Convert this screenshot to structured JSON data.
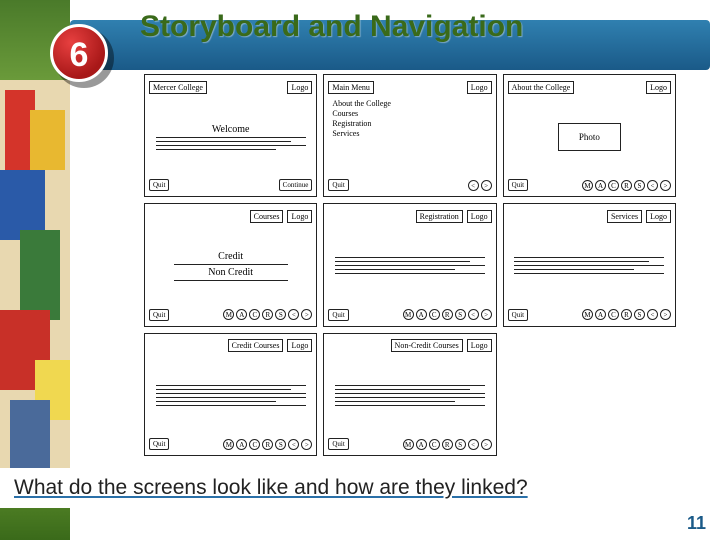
{
  "title": "Storyboard and Navigation",
  "badge_number": "6",
  "caption": "What do the screens look like and how are they linked?",
  "page_number": "11",
  "logo_label": "Logo",
  "storyboard": {
    "cells": [
      {
        "header": "Mercer College",
        "body_text": "Welcome",
        "quit": "Quit",
        "continue_btn": "Continue"
      },
      {
        "header": "Main Menu",
        "list": [
          "About the College",
          "Courses",
          "Registration",
          "Services"
        ],
        "quit": "Quit"
      },
      {
        "header": "About the College",
        "box_text": "Photo",
        "quit": "Quit",
        "nav": [
          "M",
          "A",
          "C",
          "R",
          "S"
        ]
      },
      {
        "header": "Courses",
        "body_text": "Credit",
        "body_text2": "Non Credit",
        "quit": "Quit",
        "nav": [
          "M",
          "A",
          "C",
          "R",
          "S"
        ]
      },
      {
        "header": "Registration",
        "quit": "Quit",
        "nav": [
          "M",
          "A",
          "C",
          "R",
          "S"
        ]
      },
      {
        "header": "Services",
        "quit": "Quit",
        "nav": [
          "M",
          "A",
          "C",
          "R",
          "S"
        ]
      },
      {
        "header": "Credit Courses",
        "quit": "Quit",
        "nav": [
          "M",
          "A",
          "C",
          "R",
          "S"
        ]
      },
      {
        "header": "Non-Credit Courses",
        "quit": "Quit",
        "nav": [
          "M",
          "A",
          "C",
          "R",
          "S"
        ]
      },
      {
        "empty": true
      }
    ]
  }
}
